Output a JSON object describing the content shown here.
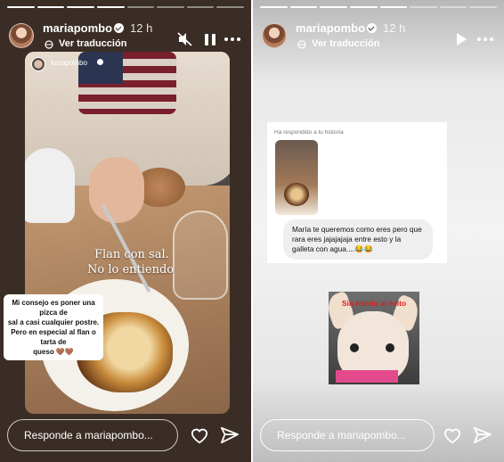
{
  "left_story": {
    "username": "mariapombo",
    "time": "12 h",
    "translate_label": "Ver traducción",
    "reposted_from": "luciapombo",
    "caption_line1": "Flan con sal.",
    "caption_line2": "No lo entiendo",
    "comment_lines": [
      "Mi consejo es poner una pizca de",
      "sal a casi cualquier postre.",
      "Pero en especial al flan o tarta de",
      "queso 🤎🤎"
    ],
    "reply_placeholder": "Responde a mariapombo..."
  },
  "right_story": {
    "username": "mariapombo",
    "time": "12 h",
    "translate_label": "Ver traducción",
    "card_label": "Ha respondido a tu historia",
    "dm_text": "María te queremos como eres pero que rara eres jajajajaja entre esto y la galleta con agua....😂😂",
    "meme_text": "Sin miedo al éxito",
    "reply_placeholder": "Responde a mariapombo..."
  },
  "colors": {
    "meme_text": "#e11d1d",
    "bubble_bg": "#efefef"
  }
}
